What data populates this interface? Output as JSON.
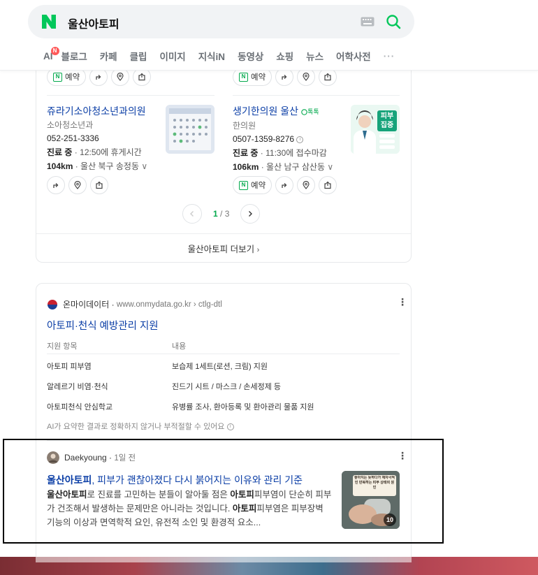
{
  "search": {
    "query": "울산아토피"
  },
  "tabs": [
    "AI",
    "블로그",
    "카페",
    "클립",
    "이미지",
    "지식iN",
    "동영상",
    "쇼핑",
    "뉴스",
    "어학사전"
  ],
  "ai_badge": "N",
  "more_tabs": "···",
  "places": {
    "top_row_buttons": {
      "reserve_label": "예약"
    },
    "items": [
      {
        "name": "쥬라기소아청소년과의원",
        "category": "소아청소년과",
        "phone": "052-251-3336",
        "status_label": "진료 중",
        "status_detail": "12:50에 휴게시간",
        "distance": "104km",
        "address": "울산 북구 송정동"
      },
      {
        "name": "생기한의원 울산",
        "talk_badge": "톡톡",
        "category": "한의원",
        "phone": "0507-1359-8276",
        "status_label": "진료 중",
        "status_detail": "11:30에 접수마감",
        "distance": "106km",
        "address": "울산 남구 삼산동",
        "reserve_label": "예약",
        "thumb_text": "피부 집중"
      }
    ],
    "pager": {
      "current": "1",
      "total": "3"
    },
    "more_link": "울산아토피 더보기"
  },
  "doc1": {
    "site_name": "온마이데이터",
    "url": "www.onmydata.go.kr › ctlg-dtl",
    "title": "아토피·천식 예방관리 지원",
    "table": {
      "headers": [
        "지원 항목",
        "내용"
      ],
      "rows": [
        [
          "아토피 피부염",
          "보습제 1세트(로션, 크림) 지원"
        ],
        [
          "알레르기 비염·천식",
          "진드기 시트 / 마스크 / 손세정제 등"
        ],
        [
          "아토피천식 안심학교",
          "유병률 조사, 환아등록 및 환아관리 물품 지원"
        ]
      ]
    },
    "ai_note": "AI가 요약한 결과로 정확하지 않거나 부적절할 수 있어요"
  },
  "doc2": {
    "author": "Daekyoung",
    "time": "1일 전",
    "title_highlight": "울산아토피",
    "title_rest": ", 피부가 괜찮아졌다 다시 붉어지는 이유와 관리 기준",
    "desc_parts": [
      {
        "text": "울산아토피",
        "bold": true
      },
      {
        "text": "로 진료를 고민하는 분들이 알아둘 점은 ",
        "bold": false
      },
      {
        "text": "아토피",
        "bold": true
      },
      {
        "text": "피부염이 단순히 피부가 건조해서 발생하는 문제만은 아니라는 것입니다. ",
        "bold": false
      },
      {
        "text": "아토피",
        "bold": true
      },
      {
        "text": "피부염은 피부장벽 기능의 이상과 면역학적 요인, 유전적 소인 및 환경적 요소...",
        "bold": false
      }
    ],
    "thumb_count": "10",
    "thumb_caption": "좋아지는 듯하다가 재자극적인 반복하는 피부 상태의 원인"
  },
  "colors": {
    "naver_green": "#03c75a",
    "link_blue": "#0b3ea6",
    "highlight_border": "#000000"
  }
}
